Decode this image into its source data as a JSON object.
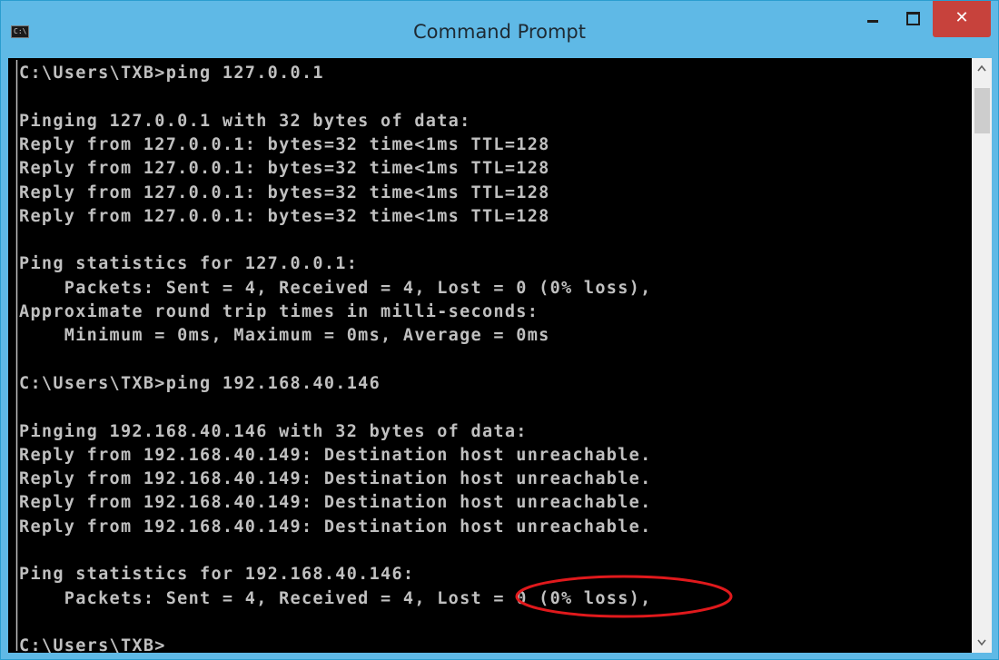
{
  "window": {
    "title": "Command Prompt",
    "app_icon_text": "C:\\",
    "controls": {
      "minimize": "minimize",
      "maximize": "maximize",
      "close": "✕"
    }
  },
  "console": {
    "lines": [
      "C:\\Users\\TXB>ping 127.0.0.1",
      "",
      "Pinging 127.0.0.1 with 32 bytes of data:",
      "Reply from 127.0.0.1: bytes=32 time<1ms TTL=128",
      "Reply from 127.0.0.1: bytes=32 time<1ms TTL=128",
      "Reply from 127.0.0.1: bytes=32 time<1ms TTL=128",
      "Reply from 127.0.0.1: bytes=32 time<1ms TTL=128",
      "",
      "Ping statistics for 127.0.0.1:",
      "    Packets: Sent = 4, Received = 4, Lost = 0 (0% loss),",
      "Approximate round trip times in milli-seconds:",
      "    Minimum = 0ms, Maximum = 0ms, Average = 0ms",
      "",
      "C:\\Users\\TXB>ping 192.168.40.146",
      "",
      "Pinging 192.168.40.146 with 32 bytes of data:",
      "Reply from 192.168.40.149: Destination host unreachable.",
      "Reply from 192.168.40.149: Destination host unreachable.",
      "Reply from 192.168.40.149: Destination host unreachable.",
      "Reply from 192.168.40.149: Destination host unreachable.",
      "",
      "Ping statistics for 192.168.40.146:",
      "    Packets: Sent = 4, Received = 4, Lost = 0 (0% loss),",
      "",
      "C:\\Users\\TXB>"
    ],
    "text_color": "#c0c0c0",
    "background_color": "#000000"
  },
  "annotation": {
    "shape": "ellipse",
    "color": "#e0191c",
    "target_text": "= 0 (0% loss),"
  },
  "colors": {
    "title_bar": "#5fb9e6",
    "close_button": "#c7423c"
  }
}
